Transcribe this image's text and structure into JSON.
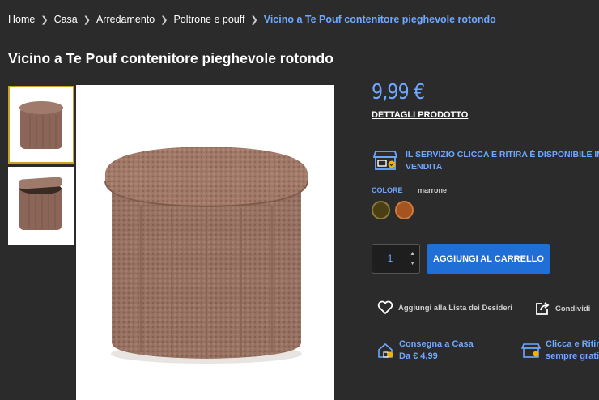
{
  "breadcrumb": {
    "items": [
      "Home",
      "Casa",
      "Arredamento",
      "Poltrone e pouff"
    ],
    "current": "Vicino a Te Pouf contenitore pieghevole rotondo"
  },
  "product": {
    "title": "Vicino a Te Pouf contenitore pieghevole rotondo",
    "price": "9,99 €",
    "details_label": "DETTAGLI PRODOTTO",
    "service_text": "IL SERVIZIO CLICCA E RITIRA  È DISPONIBILE  IN VENDITA",
    "color_label": "COLORE",
    "color_value": "marrone",
    "swatches": [
      "#4a3f14",
      "#a5531f"
    ]
  },
  "cart": {
    "quantity": "1",
    "add_label": "AGGIUNGI AL CARRELLO"
  },
  "actions": {
    "wishlist_label": "Aggiungi alla Lista dei Desideri",
    "share_label": "Condividi"
  },
  "delivery": {
    "home_title": "Consegna a Casa",
    "home_price": "Da € 4,99",
    "pickup_title": "Clicca e Ritira",
    "pickup_sub": "sempre gratis"
  },
  "colors": {
    "accent": "#6ea8ff",
    "button": "#1f6fd6",
    "background": "#2b2b2b"
  },
  "icons": [
    "chevron-right-icon",
    "store-icon",
    "heart-icon",
    "share-icon",
    "home-delivery-icon",
    "pickup-store-icon"
  ]
}
